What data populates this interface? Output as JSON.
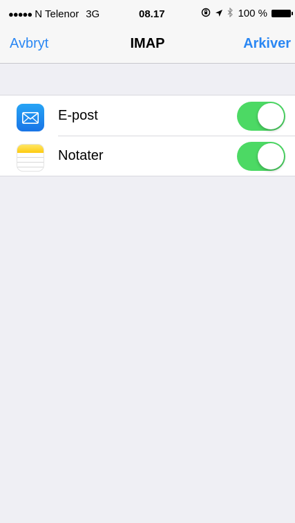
{
  "status_bar": {
    "signal": "●●●●●",
    "carrier": "N Telenor",
    "network": "3G",
    "time": "08.17",
    "icons": [
      "rotation-lock-icon",
      "location-arrow-icon",
      "bluetooth-icon"
    ],
    "battery_text": "100 %",
    "battery_level": 1.0
  },
  "nav": {
    "cancel_label": "Avbryt",
    "title": "IMAP",
    "save_label": "Arkiver"
  },
  "colors": {
    "accent": "#2a87f3",
    "toggle_on": "#4cd964",
    "background": "#efeff4"
  },
  "settings": {
    "items": [
      {
        "label": "E-post",
        "icon": "mail-app-icon",
        "enabled": true
      },
      {
        "label": "Notater",
        "icon": "notes-app-icon",
        "enabled": true
      }
    ]
  }
}
